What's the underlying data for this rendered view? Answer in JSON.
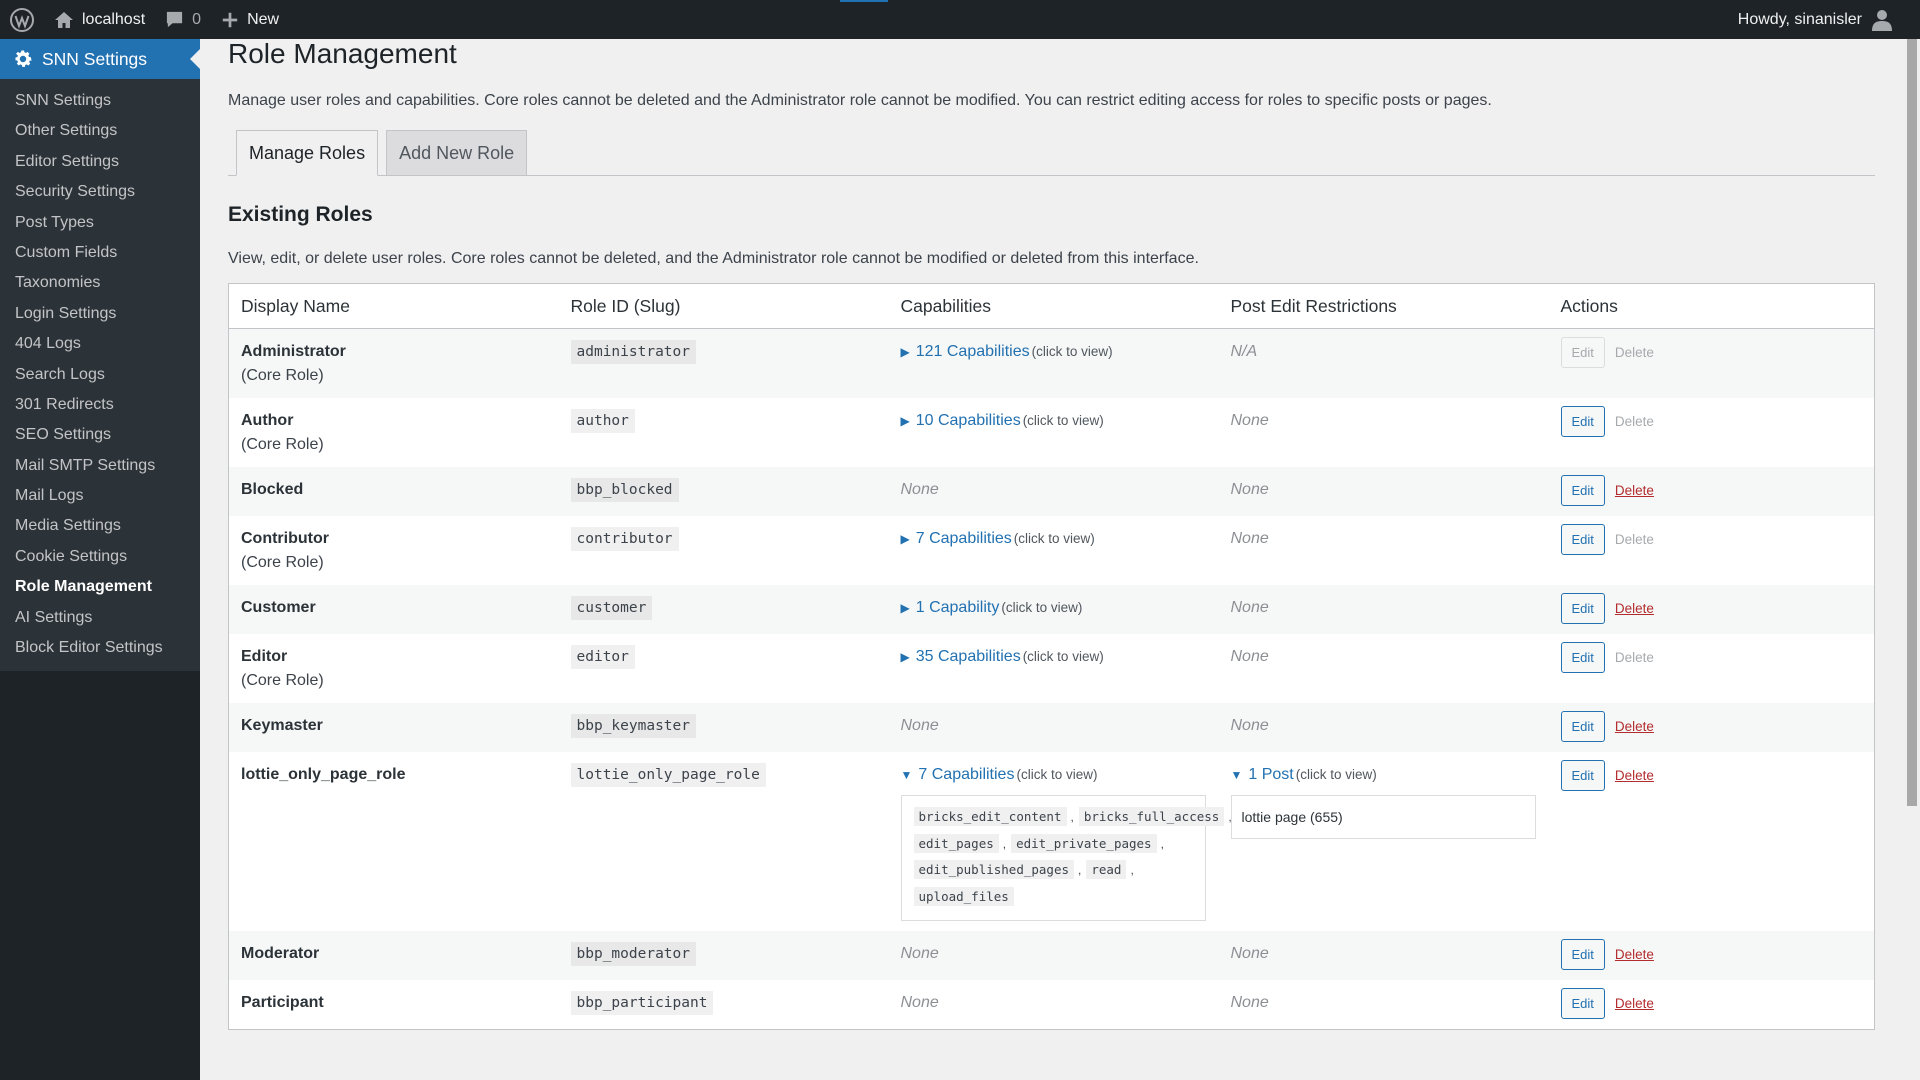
{
  "adminbar": {
    "site_name": "localhost",
    "comments_count": "0",
    "new_label": "New",
    "howdy": "Howdy, sinanisler"
  },
  "sidebar": {
    "top_label": "SNN Settings",
    "items": [
      {
        "label": "SNN Settings"
      },
      {
        "label": "Other Settings"
      },
      {
        "label": "Editor Settings"
      },
      {
        "label": "Security Settings"
      },
      {
        "label": "Post Types"
      },
      {
        "label": "Custom Fields"
      },
      {
        "label": "Taxonomies"
      },
      {
        "label": "Login Settings"
      },
      {
        "label": "404 Logs"
      },
      {
        "label": "Search Logs"
      },
      {
        "label": "301 Redirects"
      },
      {
        "label": "SEO Settings"
      },
      {
        "label": "Mail SMTP Settings"
      },
      {
        "label": "Mail Logs"
      },
      {
        "label": "Media Settings"
      },
      {
        "label": "Cookie Settings"
      },
      {
        "label": "Role Management"
      },
      {
        "label": "AI Settings"
      },
      {
        "label": "Block Editor Settings"
      }
    ],
    "current": "Role Management"
  },
  "page": {
    "title": "Role Management",
    "intro": "Manage user roles and capabilities. Core roles cannot be deleted and the Administrator role cannot be modified. You can restrict editing access for roles to specific posts or pages.",
    "tabs": [
      {
        "label": "Manage Roles"
      },
      {
        "label": "Add New Role"
      }
    ],
    "active_tab": "Manage Roles",
    "section_title": "Existing Roles",
    "section_desc": "View, edit, or delete user roles. Core roles cannot be deleted, and the Administrator role cannot be modified or deleted from this interface."
  },
  "table": {
    "headers": [
      "Display Name",
      "Role ID (Slug)",
      "Capabilities",
      "Post Edit Restrictions",
      "Actions"
    ],
    "core_label": "(Core Role)",
    "click_hint": "(click to view)",
    "edit_label": "Edit",
    "delete_label": "Delete",
    "none_label": "None",
    "na_label": "N/A",
    "rows": [
      {
        "name": "Administrator",
        "core": true,
        "slug": "administrator",
        "caps": "121 Capabilities",
        "restrict": "N/A",
        "edit_enabled": false,
        "delete_enabled": false
      },
      {
        "name": "Author",
        "core": true,
        "slug": "author",
        "caps": "10 Capabilities",
        "restrict": "None",
        "edit_enabled": true,
        "delete_enabled": false
      },
      {
        "name": "Blocked",
        "core": false,
        "slug": "bbp_blocked",
        "caps": "None",
        "restrict": "None",
        "edit_enabled": true,
        "delete_enabled": true
      },
      {
        "name": "Contributor",
        "core": true,
        "slug": "contributor",
        "caps": "7 Capabilities",
        "restrict": "None",
        "edit_enabled": true,
        "delete_enabled": false
      },
      {
        "name": "Customer",
        "core": false,
        "slug": "customer",
        "caps": "1 Capability",
        "restrict": "None",
        "edit_enabled": true,
        "delete_enabled": true
      },
      {
        "name": "Editor",
        "core": true,
        "slug": "editor",
        "caps": "35 Capabilities",
        "restrict": "None",
        "edit_enabled": true,
        "delete_enabled": false
      },
      {
        "name": "Keymaster",
        "core": false,
        "slug": "bbp_keymaster",
        "caps": "None",
        "restrict": "None",
        "edit_enabled": true,
        "delete_enabled": true
      },
      {
        "name": "lottie_only_page_role",
        "core": false,
        "slug": "lottie_only_page_role",
        "caps": "7 Capabilities",
        "caps_expanded": true,
        "cap_list": [
          "bricks_edit_content",
          "bricks_full_access",
          "edit_pages",
          "edit_private_pages",
          "edit_published_pages",
          "read",
          "upload_files"
        ],
        "restrict": "1 Post",
        "restrict_expanded": true,
        "restrict_list": [
          "lottie page (655)"
        ],
        "edit_enabled": true,
        "delete_enabled": true
      },
      {
        "name": "Moderator",
        "core": false,
        "slug": "bbp_moderator",
        "caps": "None",
        "restrict": "None",
        "edit_enabled": true,
        "delete_enabled": true
      },
      {
        "name": "Participant",
        "core": false,
        "slug": "bbp_participant",
        "caps": "None",
        "restrict": "None",
        "edit_enabled": true,
        "delete_enabled": true
      }
    ]
  }
}
